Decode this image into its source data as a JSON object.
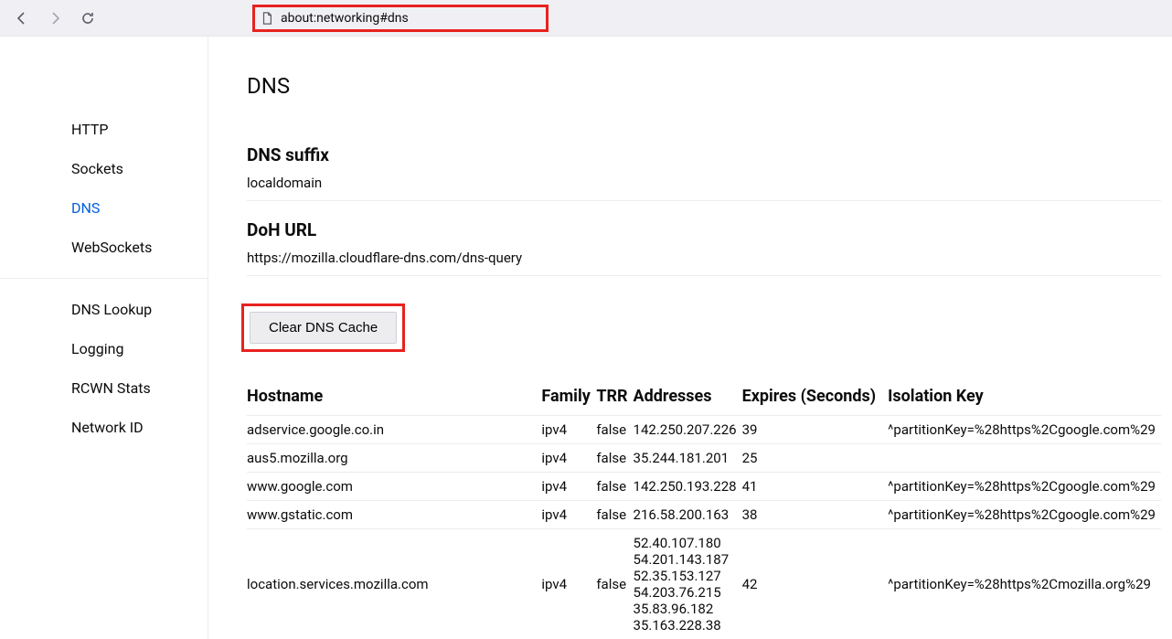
{
  "toolbar": {
    "url": "about:networking#dns"
  },
  "sidebar": {
    "group1": [
      {
        "label": "HTTP"
      },
      {
        "label": "Sockets"
      },
      {
        "label": "DNS"
      },
      {
        "label": "WebSockets"
      }
    ],
    "group2": [
      {
        "label": "DNS Lookup"
      },
      {
        "label": "Logging"
      },
      {
        "label": "RCWN Stats"
      },
      {
        "label": "Network ID"
      }
    ]
  },
  "page": {
    "title": "DNS",
    "dns_suffix_head": "DNS suffix",
    "dns_suffix_value": "localdomain",
    "doh_head": "DoH URL",
    "doh_value": "https://mozilla.cloudflare-dns.com/dns-query",
    "clear_btn": "Clear DNS Cache"
  },
  "table": {
    "headers": {
      "hostname": "Hostname",
      "family": "Family",
      "trr": "TRR",
      "addresses": "Addresses",
      "expires": "Expires (Seconds)",
      "isolation": "Isolation Key"
    },
    "rows": [
      {
        "hostname": "adservice.google.co.in",
        "family": "ipv4",
        "trr": "false",
        "addresses": [
          "142.250.207.226"
        ],
        "expires": "39",
        "isolation": "^partitionKey=%28https%2Cgoogle.com%29"
      },
      {
        "hostname": "aus5.mozilla.org",
        "family": "ipv4",
        "trr": "false",
        "addresses": [
          "35.244.181.201"
        ],
        "expires": "25",
        "isolation": ""
      },
      {
        "hostname": "www.google.com",
        "family": "ipv4",
        "trr": "false",
        "addresses": [
          "142.250.193.228"
        ],
        "expires": "41",
        "isolation": "^partitionKey=%28https%2Cgoogle.com%29"
      },
      {
        "hostname": "www.gstatic.com",
        "family": "ipv4",
        "trr": "false",
        "addresses": [
          "216.58.200.163"
        ],
        "expires": "38",
        "isolation": "^partitionKey=%28https%2Cgoogle.com%29"
      },
      {
        "hostname": "location.services.mozilla.com",
        "family": "ipv4",
        "trr": "false",
        "addresses": [
          "52.40.107.180",
          "54.201.143.187",
          "52.35.153.127",
          "54.203.76.215",
          "35.83.96.182",
          "35.163.228.38"
        ],
        "expires": "42",
        "isolation": "^partitionKey=%28https%2Cmozilla.org%29"
      }
    ]
  }
}
